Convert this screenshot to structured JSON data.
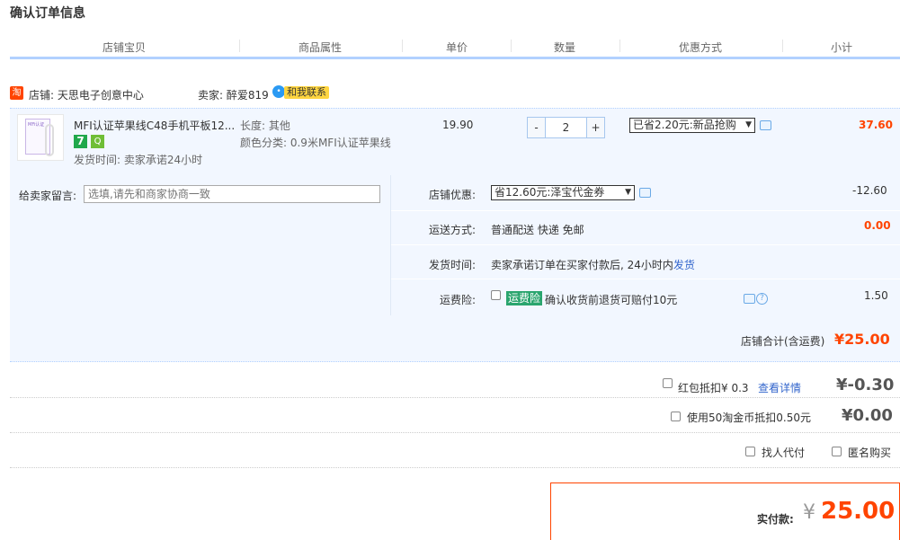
{
  "page": {
    "title": "确认订单信息"
  },
  "columns": [
    "店铺宝贝",
    "商品属性",
    "单价",
    "数量",
    "优惠方式",
    "小计"
  ],
  "shop": {
    "icon_text": "淘",
    "label": "店铺: 天思电子创意中心",
    "seller_label": "卖家: 醉爱819",
    "contact_label": "和我联系"
  },
  "item": {
    "thumb_caption": "MFi认证",
    "title": "MFI认证苹果线C48手机平板12...",
    "tag_seven": "7",
    "tag_q": "Q",
    "ship_time": "发货时间: 卖家承诺24小时",
    "attr_length": "长度: 其他",
    "attr_color": "颜色分类: 0.9米MFI认证苹果线",
    "unit_price": "19.90",
    "qty_minus": "-",
    "qty_value": "2",
    "qty_plus": "+",
    "discount_select": "已省2.20元:新品抢购",
    "subtotal": "37.60"
  },
  "message": {
    "label": "给卖家留言:",
    "placeholder": "选填,请先和商家协商一致"
  },
  "shop_discount": {
    "label": "店铺优惠:",
    "select": "省12.60元:泽宝代金券",
    "value": "-12.60"
  },
  "shipping": {
    "label": "运送方式:",
    "value": "普通配送 快递 免邮",
    "cost": "0.00"
  },
  "delivery": {
    "label": "发货时间:",
    "text": "卖家承诺订单在买家付款后, 24小时内",
    "link": "发货"
  },
  "insurance": {
    "label": "运费险:",
    "tag": "运费险",
    "text": "确认收货前退货可赔付10元",
    "cost": "1.50",
    "help": "?"
  },
  "shop_total": {
    "label": "店铺合计(含运费)",
    "value": "¥25.00"
  },
  "red_packet": {
    "label": "红包抵扣¥ 0.3",
    "link": "查看详情",
    "value": "¥-0.30"
  },
  "coins": {
    "label": "使用50淘金币抵扣0.50元",
    "value": "¥0.00"
  },
  "options": {
    "proxy_pay": "找人代付",
    "anonymous": "匿名购买"
  },
  "payment": {
    "label": "实付款:",
    "currency": "¥",
    "amount": "25.00"
  }
}
